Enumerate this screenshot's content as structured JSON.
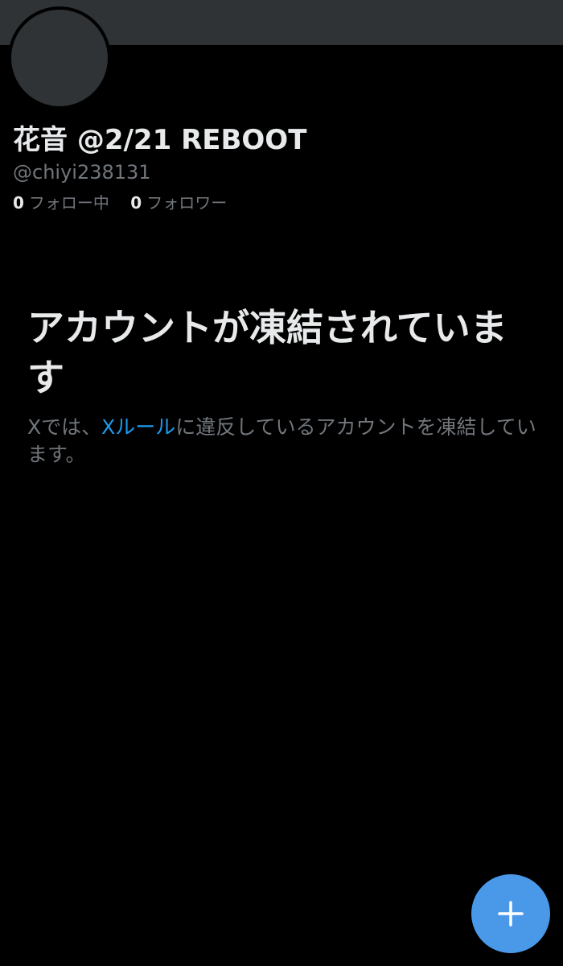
{
  "profile": {
    "display_name": "花音 @2/21 REBOOT",
    "handle": "@chiyi238131",
    "following_count": "0",
    "following_label": "フォロー中",
    "followers_count": "0",
    "followers_label": "フォロワー"
  },
  "suspended": {
    "title": "アカウントが凍結されています",
    "text_before": "Xでは、",
    "rules_link": "Xルール",
    "text_after": "に違反しているアカウントを凍結しています。"
  },
  "fab": {
    "icon": "plus-icon"
  },
  "colors": {
    "background": "#000000",
    "banner": "#2f3336",
    "primary_text": "#e7e9ea",
    "secondary_text": "#71767b",
    "link": "#1d9bf0",
    "fab": "#4a99e9"
  }
}
